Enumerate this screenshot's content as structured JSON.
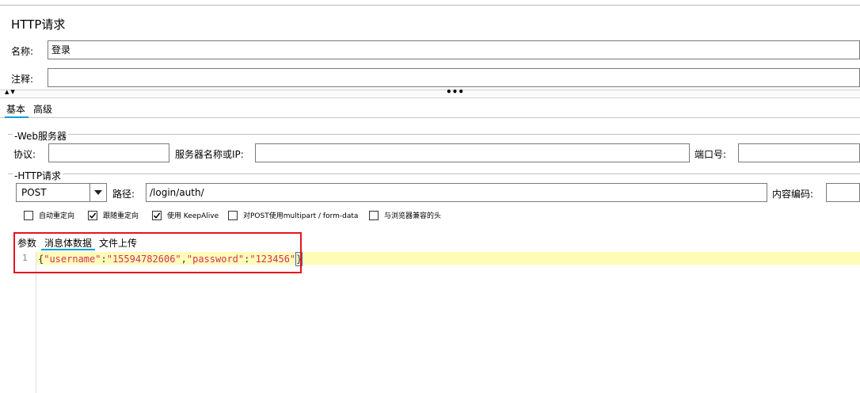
{
  "panel_title": "HTTP请求",
  "name": {
    "label": "名称:",
    "value": "登录"
  },
  "comment": {
    "label": "注释:",
    "value": ""
  },
  "tabs": [
    {
      "label": "基本",
      "active": true
    },
    {
      "label": "高级",
      "active": false
    }
  ],
  "web_server": {
    "legend": "Web服务器",
    "protocol_label": "协议:",
    "protocol_value": "",
    "server_label": "服务器名称或IP:",
    "server_value": "",
    "port_label": "端口号:",
    "port_value": ""
  },
  "http_request": {
    "legend": "HTTP请求",
    "method": "POST",
    "path_label": "路径:",
    "path_value": "/login/auth/",
    "encoding_label": "内容编码:",
    "encoding_value": ""
  },
  "options": [
    {
      "label": "自动重定向",
      "checked": false
    },
    {
      "label": "跟随重定向",
      "checked": true
    },
    {
      "label": "使用 KeepAlive",
      "checked": true
    },
    {
      "label": "对POST使用multipart / form-data",
      "checked": false
    },
    {
      "label": "与浏览器兼容的头",
      "checked": false
    }
  ],
  "sub_tabs": [
    {
      "label": "参数",
      "active": false
    },
    {
      "label": "消息体数据",
      "active": true
    },
    {
      "label": "文件上传",
      "active": false
    }
  ],
  "editor": {
    "line_number": "1",
    "code_tokens": [
      "{",
      "\"username\"",
      ":",
      "\"15594782606\"",
      ",",
      "\"password\"",
      ":",
      "\"123456\"",
      "}"
    ]
  },
  "colors": {
    "accent": "#00a0d2",
    "highlight_box": "#e8131b",
    "line_highlight": "#fffcb7",
    "string_key": "#d03060"
  }
}
